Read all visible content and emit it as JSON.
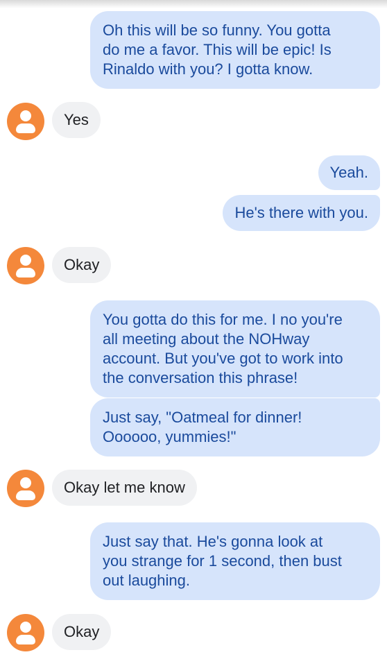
{
  "messages": [
    {
      "id": "m1",
      "direction": "outgoing",
      "text": "Oh this will be so funny.  You gotta\ndo me a favor.  This will be epic! Is\nRinaldo with you?  I gotta know."
    },
    {
      "id": "m2",
      "direction": "incoming",
      "text": "Yes"
    },
    {
      "id": "m3",
      "direction": "outgoing",
      "text": "Yeah."
    },
    {
      "id": "m4",
      "direction": "outgoing",
      "text": "He's there with you."
    },
    {
      "id": "m5",
      "direction": "incoming",
      "text": "Okay"
    },
    {
      "id": "m6",
      "direction": "outgoing",
      "text": "You gotta do this for me.  I no you're\nall meeting about the NOHway\naccount. But you've got to work into\nthe conversation this phrase!"
    },
    {
      "id": "m7",
      "direction": "outgoing",
      "text": "Just say, \"Oatmeal for dinner!\nOooooo, yummies!\""
    },
    {
      "id": "m8",
      "direction": "incoming",
      "text": "Okay let me know"
    },
    {
      "id": "m9",
      "direction": "outgoing",
      "text": "Just say that.  He's gonna look at\nyou strange for 1 second, then bust\nout laughing."
    },
    {
      "id": "m10",
      "direction": "incoming",
      "text": "Okay"
    }
  ],
  "colors": {
    "outgoing_bubble": "#d6e4fb",
    "outgoing_text": "#1a4a9c",
    "incoming_bubble": "#f0f1f3",
    "incoming_text": "#202124",
    "avatar": "#f4883b"
  },
  "icons": {
    "contact_avatar": "person-icon"
  }
}
